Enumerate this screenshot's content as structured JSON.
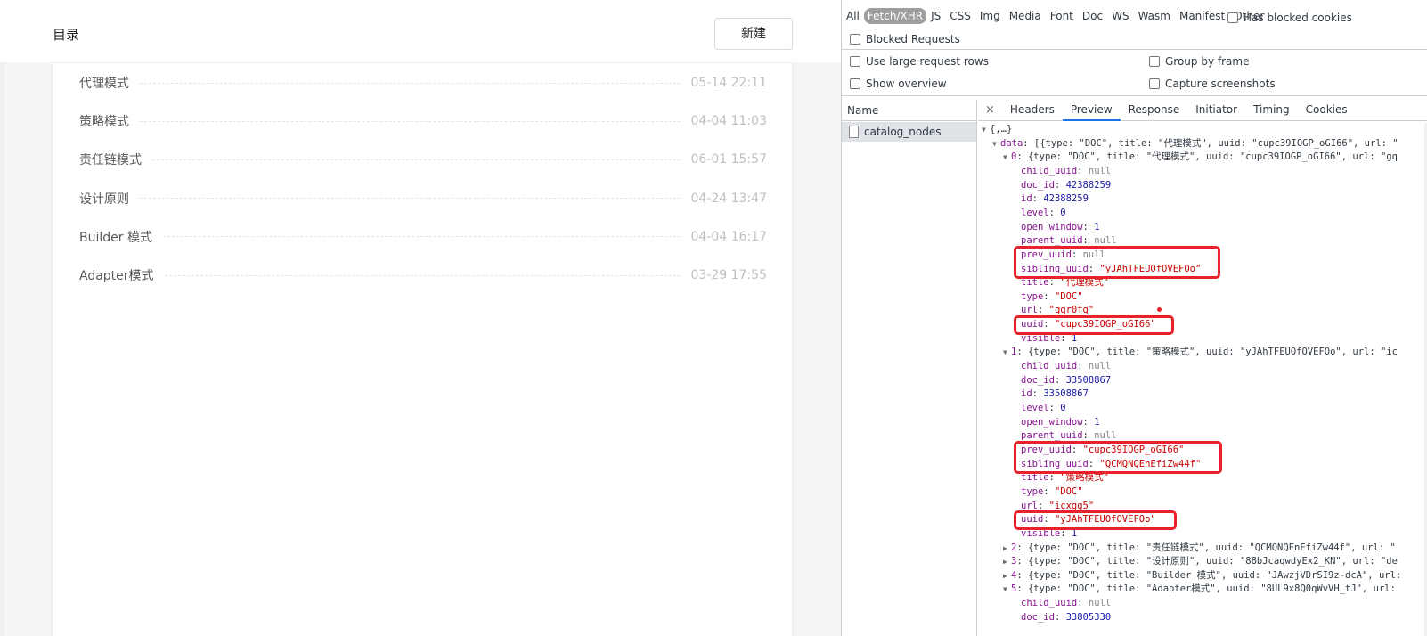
{
  "catalog": {
    "title": "目录",
    "new_button": "新建",
    "items": [
      {
        "name": "代理模式",
        "time": "05-14 22:11"
      },
      {
        "name": "策略模式",
        "time": "04-04 11:03"
      },
      {
        "name": "责任链模式",
        "time": "06-01 15:57"
      },
      {
        "name": "设计原则",
        "time": "04-24 13:47"
      },
      {
        "name": "Builder 模式",
        "time": "04-04 16:17"
      },
      {
        "name": "Adapter模式",
        "time": "03-29 17:55"
      }
    ]
  },
  "devtools": {
    "filters": [
      "All",
      "Fetch/XHR",
      "JS",
      "CSS",
      "Img",
      "Media",
      "Font",
      "Doc",
      "WS",
      "Wasm",
      "Manifest",
      "Other"
    ],
    "selected_filter": "Fetch/XHR",
    "has_blocked_cookies": "Has blocked cookies",
    "blocked_requests": "Blocked Requests",
    "use_large_rows": "Use large request rows",
    "group_by_frame": "Group by frame",
    "show_overview": "Show overview",
    "capture_screenshots": "Capture screenshots",
    "name_header": "Name",
    "request_name": "catalog_nodes",
    "close_glyph": "×",
    "tabs": [
      "Headers",
      "Preview",
      "Response",
      "Initiator",
      "Timing",
      "Cookies"
    ],
    "active_tab": "Preview",
    "tree": {
      "root": "{,…}",
      "data_key": "data",
      "data_summary": "[{type: \"DOC\", title: \"代理模式\", uuid: \"cupc39IOGP_oGI66\", url: \"",
      "i0_summary": "{type: \"DOC\", title: \"代理模式\", uuid: \"cupc39IOGP_oGI66\", url: \"gq",
      "i0": [
        {
          "k": "child_uuid",
          "v": "null",
          "t": "nl"
        },
        {
          "k": "doc_id",
          "v": "42388259",
          "t": "n"
        },
        {
          "k": "id",
          "v": "42388259",
          "t": "n"
        },
        {
          "k": "level",
          "v": "0",
          "t": "n"
        },
        {
          "k": "open_window",
          "v": "1",
          "t": "n"
        },
        {
          "k": "parent_uuid",
          "v": "null",
          "t": "nl"
        },
        {
          "k": "prev_uuid",
          "v": "null",
          "t": "nl"
        },
        {
          "k": "sibling_uuid",
          "v": "\"yJAhTFEUOfOVEFOo\"",
          "t": "s"
        },
        {
          "k": "title",
          "v": "\"代理模式\"",
          "t": "s"
        },
        {
          "k": "type",
          "v": "\"DOC\"",
          "t": "s"
        },
        {
          "k": "url",
          "v": "\"gqr0fg\"",
          "t": "s"
        },
        {
          "k": "uuid",
          "v": "\"cupc39IOGP_oGI66\"",
          "t": "s"
        },
        {
          "k": "visible",
          "v": "1",
          "t": "n"
        }
      ],
      "i1_summary": "{type: \"DOC\", title: \"策略模式\", uuid: \"yJAhTFEUOfOVEFOo\", url: \"ic",
      "i1": [
        {
          "k": "child_uuid",
          "v": "null",
          "t": "nl"
        },
        {
          "k": "doc_id",
          "v": "33508867",
          "t": "n"
        },
        {
          "k": "id",
          "v": "33508867",
          "t": "n"
        },
        {
          "k": "level",
          "v": "0",
          "t": "n"
        },
        {
          "k": "open_window",
          "v": "1",
          "t": "n"
        },
        {
          "k": "parent_uuid",
          "v": "null",
          "t": "nl"
        },
        {
          "k": "prev_uuid",
          "v": "\"cupc39IOGP_oGI66\"",
          "t": "s"
        },
        {
          "k": "sibling_uuid",
          "v": "\"QCMQNQEnEfiZw44f\"",
          "t": "s"
        },
        {
          "k": "title",
          "v": "\"策略模式\"",
          "t": "s"
        },
        {
          "k": "type",
          "v": "\"DOC\"",
          "t": "s"
        },
        {
          "k": "url",
          "v": "\"icxgg5\"",
          "t": "s"
        },
        {
          "k": "uuid",
          "v": "\"yJAhTFEUOfOVEFOo\"",
          "t": "s"
        },
        {
          "k": "visible",
          "v": "1",
          "t": "n"
        }
      ],
      "collapsed": [
        {
          "idx": "2",
          "summary": "{type: \"DOC\", title: \"责任链模式\", uuid: \"QCMQNQEnEfiZw44f\", url: \""
        },
        {
          "idx": "3",
          "summary": "{type: \"DOC\", title: \"设计原则\", uuid: \"88bJcaqwdyEx2_KN\", url: \"de"
        },
        {
          "idx": "4",
          "summary": "{type: \"DOC\", title: \"Builder 模式\", uuid: \"JAwzjVDrSI9z-dcA\", url:"
        }
      ],
      "i5_summary": "{type: \"DOC\", title: \"Adapter模式\", uuid: \"8UL9x8Q0qWvVH_tJ\", url:",
      "i5": [
        {
          "k": "child_uuid",
          "v": "null",
          "t": "nl"
        },
        {
          "k": "doc_id",
          "v": "33805330",
          "t": "n"
        }
      ]
    }
  }
}
